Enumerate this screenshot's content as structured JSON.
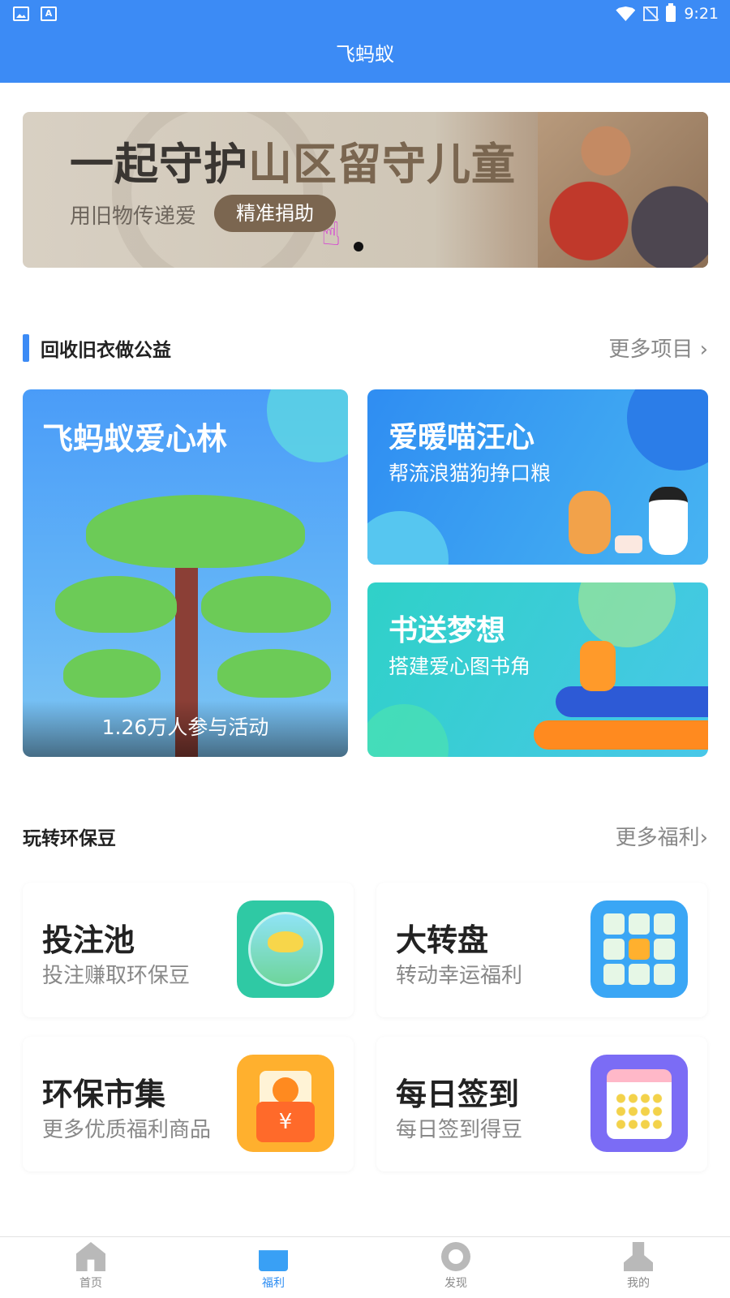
{
  "status_bar": {
    "time": "9:21"
  },
  "app_title": "飞蚂蚁",
  "banner": {
    "headline_part1": "一起守护",
    "headline_part2": "山区留守儿童",
    "subtitle": "用旧物传递爱",
    "button": "精准捐助"
  },
  "section_recycle": {
    "title": "回收旧衣做公益",
    "more": "更多项目"
  },
  "projects": {
    "forest": {
      "title": "飞蚂蚁爱心林",
      "participants": "1.26万人参与活动"
    },
    "pets": {
      "title": "爱暖喵汪心",
      "subtitle": "帮流浪猫狗挣口粮"
    },
    "books": {
      "title": "书送梦想",
      "subtitle": "搭建爱心图书角"
    }
  },
  "section_beans": {
    "title": "玩转环保豆",
    "more": "更多福利"
  },
  "benefits": [
    {
      "title": "投注池",
      "subtitle": "投注赚取环保豆",
      "icon": "betting-pool-icon",
      "color": "#2fc9a4"
    },
    {
      "title": "大转盘",
      "subtitle": "转动幸运福利",
      "icon": "lucky-wheel-icon",
      "color": "#3aa6f5"
    },
    {
      "title": "环保市集",
      "subtitle": "更多优质福利商品",
      "icon": "market-icon",
      "color": "#ffb02e"
    },
    {
      "title": "每日签到",
      "subtitle": "每日签到得豆",
      "icon": "calendar-icon",
      "color": "#7b6cf5"
    }
  ],
  "tabs": [
    {
      "label": "首页",
      "icon": "home-icon"
    },
    {
      "label": "福利",
      "icon": "gift-icon",
      "active": true
    },
    {
      "label": "发现",
      "icon": "discover-icon"
    },
    {
      "label": "我的",
      "icon": "profile-icon"
    }
  ]
}
